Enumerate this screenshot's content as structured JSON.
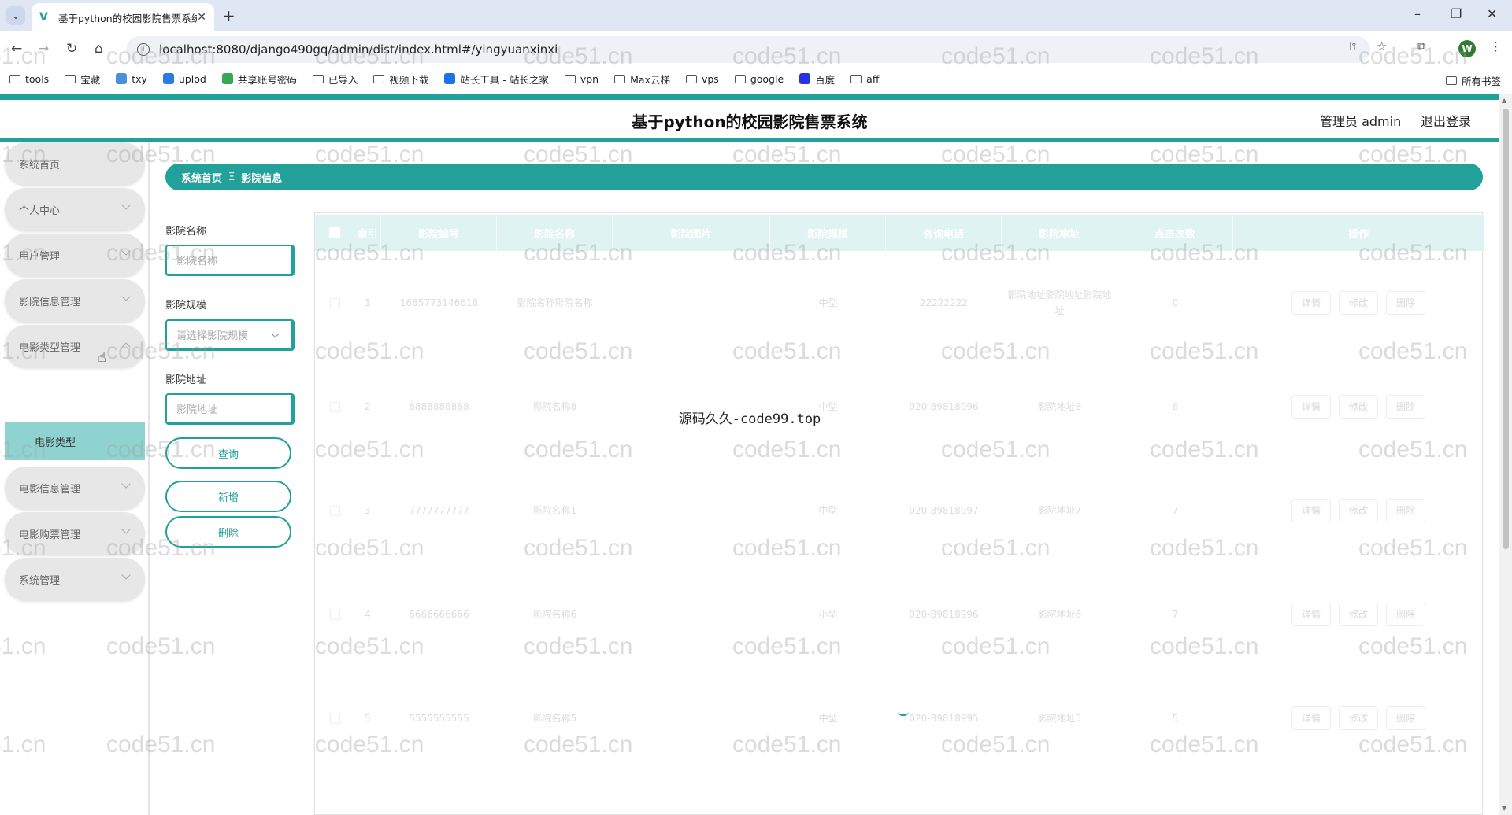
{
  "browser": {
    "tab_title": "基于python的校园影院售票系统",
    "url": "localhost:8080/django490gq/admin/dist/index.html#/yingyuanxinxi",
    "bookmarks": [
      "tools",
      "宝藏",
      "txy",
      "uplod",
      "共享账号密码",
      "已导入",
      "视频下载",
      "站长工具 - 站长之家",
      "vpn",
      "Max云梯",
      "vps",
      "google",
      "百度",
      "aff"
    ],
    "bookmarks_right": "所有书签",
    "profile_initial": "W"
  },
  "header": {
    "title": "基于python的校园影院售票系统",
    "admin": "管理员 admin",
    "logout": "退出登录"
  },
  "sidebar": {
    "items": [
      {
        "label": "系统首页",
        "chevron": "none"
      },
      {
        "label": "个人中心",
        "chevron": "down"
      },
      {
        "label": "用户管理",
        "chevron": "down"
      },
      {
        "label": "影院信息管理",
        "chevron": "down"
      },
      {
        "label": "电影类型管理",
        "chevron": "up"
      },
      {
        "label": "电影信息管理",
        "chevron": "down"
      },
      {
        "label": "电影购票管理",
        "chevron": "down"
      },
      {
        "label": "系统管理",
        "chevron": "down"
      }
    ],
    "active_sub": "电影类型"
  },
  "breadcrumb": {
    "home": "系统首页",
    "separator": "Ξ",
    "current": "影院信息"
  },
  "filters": {
    "name_label": "影院名称",
    "name_placeholder": "影院名称",
    "scale_label": "影院规模",
    "scale_placeholder": "请选择影院规模",
    "address_label": "影院地址",
    "address_placeholder": "影院地址",
    "query_button": "查询",
    "add_button": "新增",
    "delete_button": "删除"
  },
  "table": {
    "headers": [
      "索引",
      "影院编号",
      "影院名称",
      "影院图片",
      "影院规模",
      "咨询电话",
      "影院地址",
      "点击次数",
      "操作"
    ],
    "rows": [
      [
        "1",
        "1685773146618",
        "影院名称影院名称",
        "",
        "中型",
        "22222222",
        "影院地址影院地址影院地址",
        "0"
      ],
      [
        "2",
        "8888888888",
        "影院名称8",
        "",
        "中型",
        "020-89818996",
        "影院地址8",
        "8"
      ],
      [
        "3",
        "7777777777",
        "影院名称1",
        "",
        "中型",
        "020-89818997",
        "影院地址7",
        "7"
      ],
      [
        "4",
        "6666666666",
        "影院名称6",
        "",
        "小型",
        "020-89818996",
        "影院地址6",
        "7"
      ],
      [
        "5",
        "5555555555",
        "影院名称5",
        "",
        "中型",
        "020-89818995",
        "影院地址5",
        "5"
      ]
    ],
    "ops": [
      "详情",
      "修改",
      "删除"
    ]
  },
  "loading_text": "源码久久-code99.top",
  "watermark": "code51.cn",
  "colors": {
    "accent": "#21a19a",
    "header_bg": "#dff3f2",
    "active_sub": "#8fd3d0"
  }
}
